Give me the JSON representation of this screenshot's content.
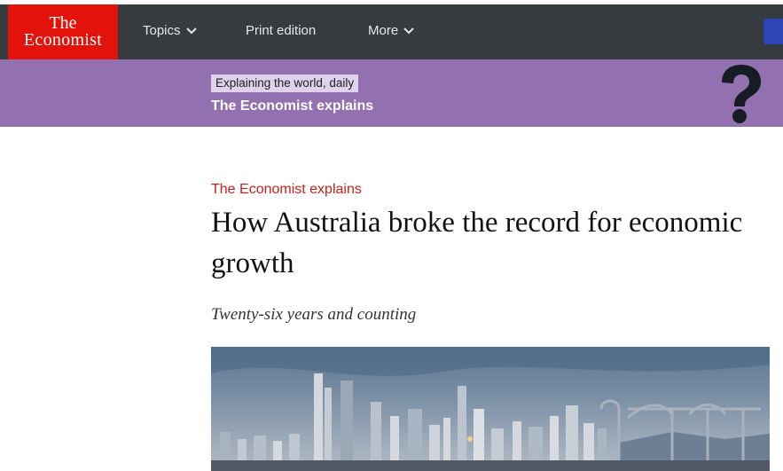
{
  "header": {
    "logo_line1": "The",
    "logo_line2": "Economist",
    "nav": [
      {
        "label": "Topics",
        "has_dropdown": true
      },
      {
        "label": "Print edition",
        "has_dropdown": false
      },
      {
        "label": "More",
        "has_dropdown": true
      }
    ],
    "colors": {
      "bar": "#363b40",
      "logo": "#e3120b",
      "subscribe": "#2e45b8"
    }
  },
  "banner": {
    "tag": "Explaining the world, daily",
    "title": "The Economist explains",
    "icon": "question-mark-icon",
    "color": "#9370b0"
  },
  "article": {
    "section": "The Economist explains",
    "headline": "How Australia broke the record for economic growth",
    "subhead": "Twenty-six years and counting",
    "image_icon": "city-skyline-photo"
  }
}
